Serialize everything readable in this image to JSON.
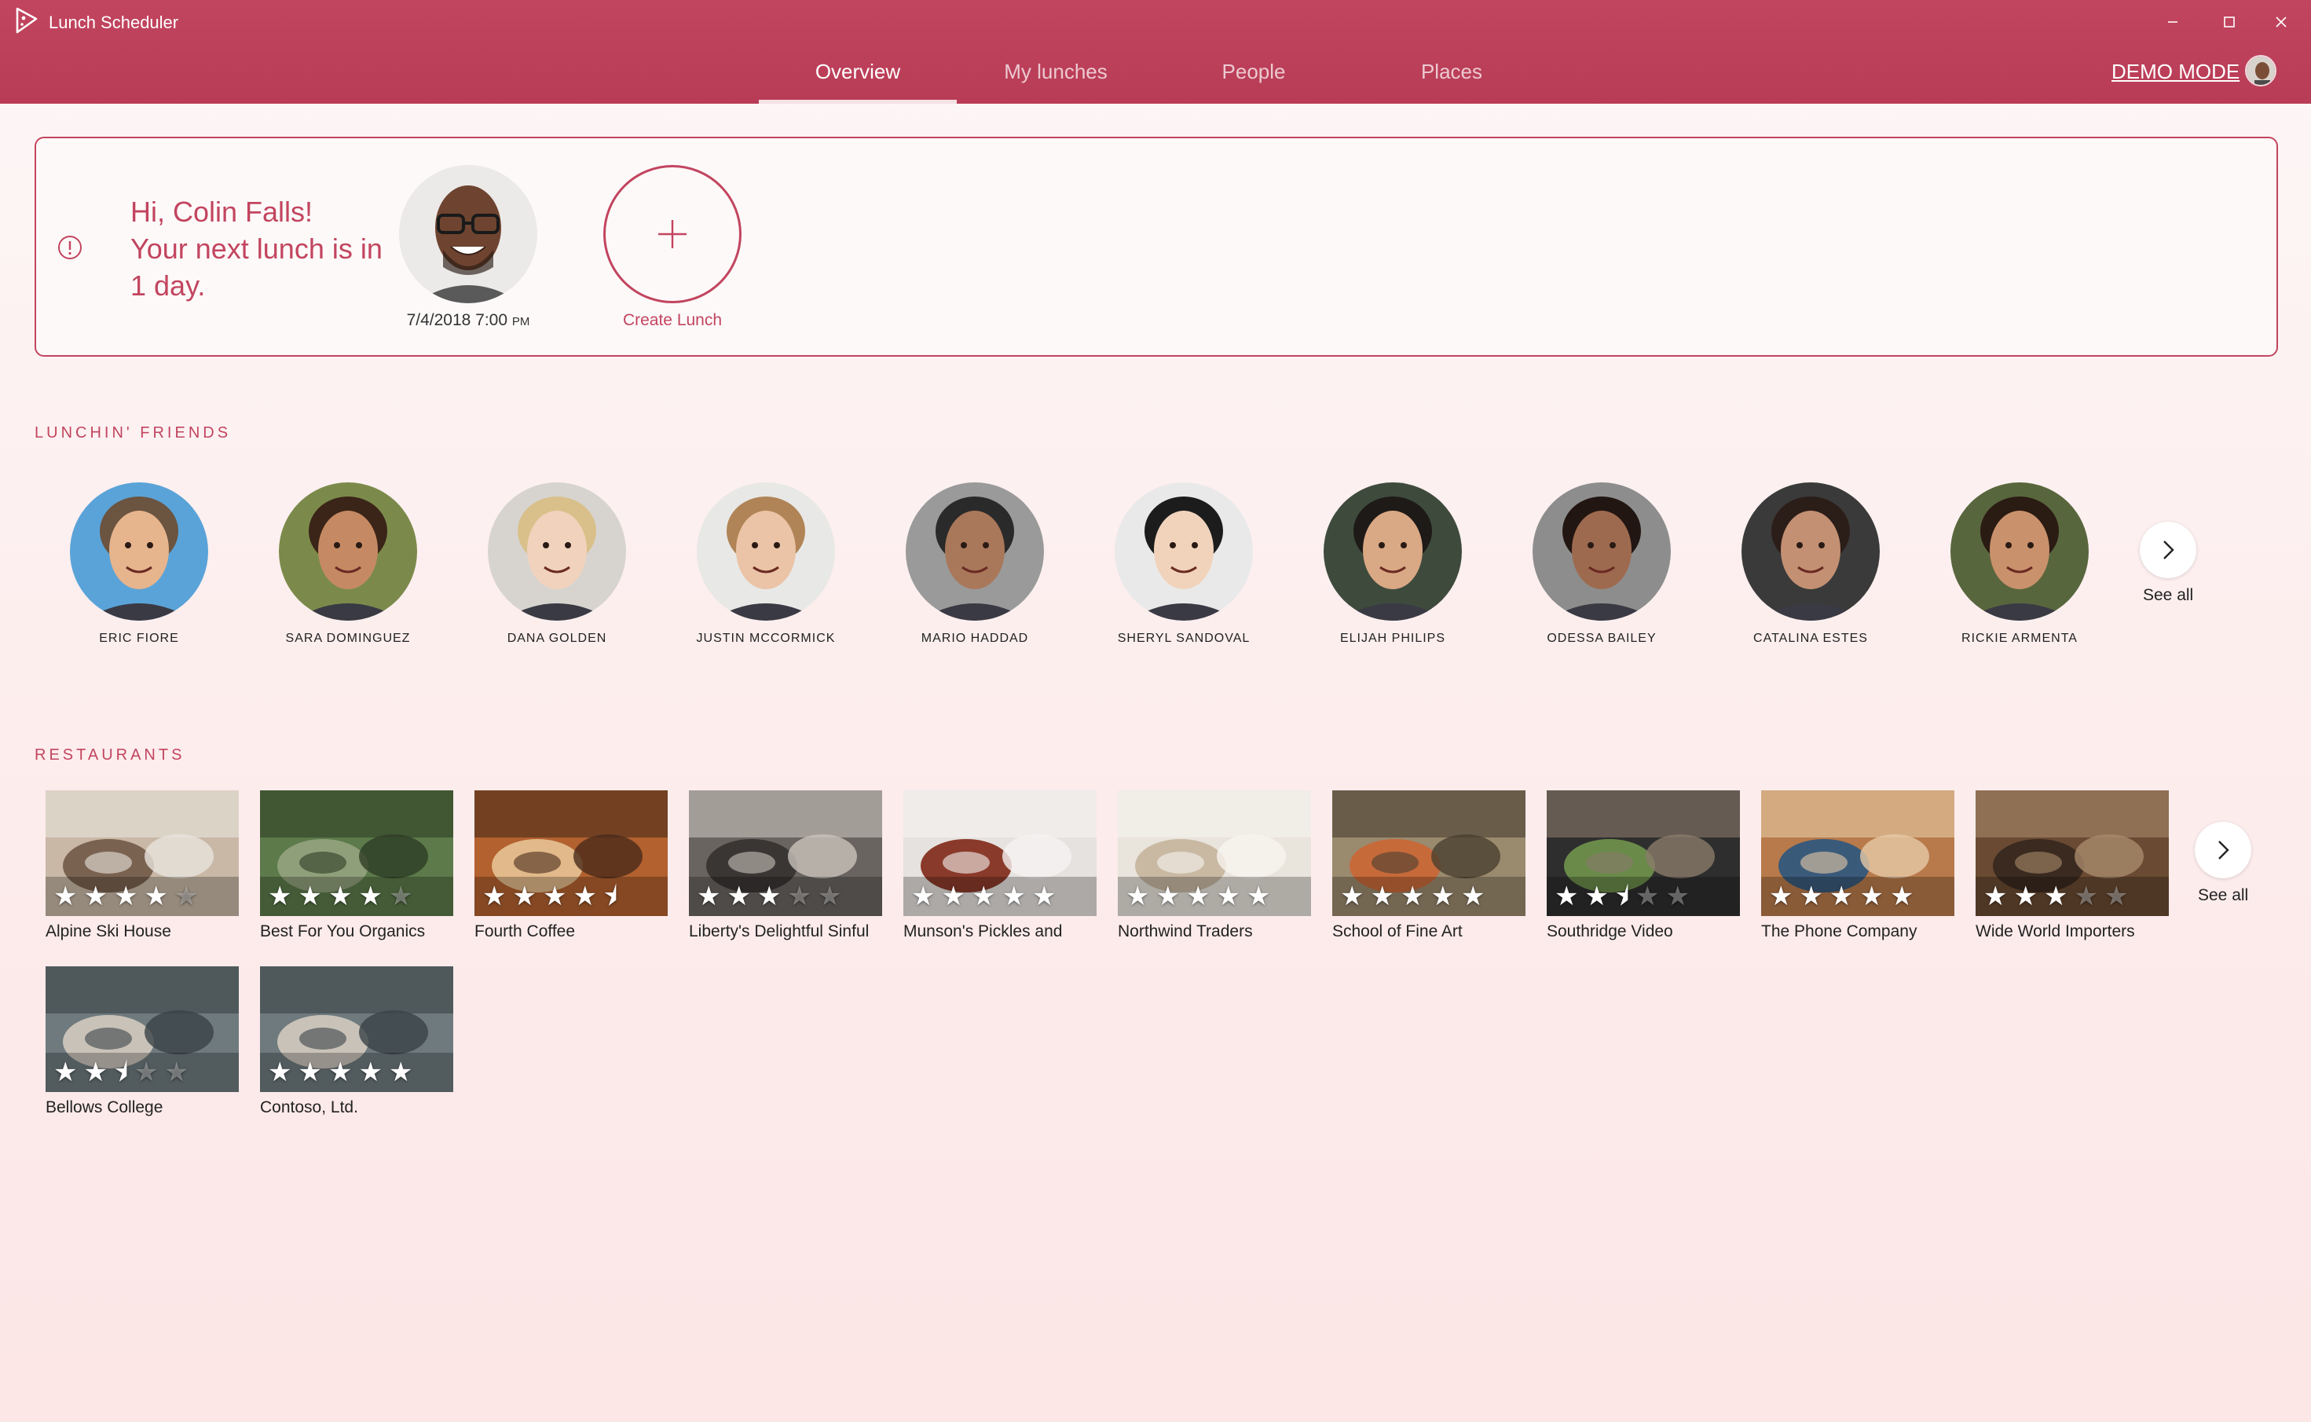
{
  "window": {
    "title": "Lunch Scheduler",
    "demo_mode_label": "DEMO MODE"
  },
  "nav": {
    "tabs": [
      {
        "label": "Overview",
        "active": true
      },
      {
        "label": "My lunches",
        "active": false
      },
      {
        "label": "People",
        "active": false
      },
      {
        "label": "Places",
        "active": false
      }
    ]
  },
  "welcome": {
    "greeting_line1": "Hi, Colin Falls!",
    "greeting_line2": "Your next lunch is in",
    "greeting_line3": "1 day.",
    "next_lunch_date": "7/4/2018 7:00",
    "next_lunch_ampm": "PM",
    "create_label": "Create Lunch"
  },
  "friends": {
    "title": "Lunchin' Friends",
    "see_all": "See all",
    "items": [
      {
        "name": "Eric Fiore",
        "skin": "#e6b48d",
        "hair": "#6b5440",
        "bg": "#5aa3d8"
      },
      {
        "name": "Sara Dominguez",
        "skin": "#c58a64",
        "hair": "#3b2418",
        "bg": "#7b8a4a"
      },
      {
        "name": "Dana Golden",
        "skin": "#f1d2bd",
        "hair": "#d9c08a",
        "bg": "#d7d4d0"
      },
      {
        "name": "Justin McCormick",
        "skin": "#ebc3a6",
        "hair": "#b08456",
        "bg": "#e8e8e6"
      },
      {
        "name": "Mario Haddad",
        "skin": "#a9775a",
        "hair": "#2a2a2a",
        "bg": "#9a9a9a"
      },
      {
        "name": "Sheryl Sandoval",
        "skin": "#f1d3bc",
        "hair": "#1c1c1c",
        "bg": "#e9e9e9"
      },
      {
        "name": "Elijah Philips",
        "skin": "#d9a884",
        "hair": "#1e1a18",
        "bg": "#3e4b3c"
      },
      {
        "name": "Odessa Bailey",
        "skin": "#9e6a4f",
        "hair": "#221612",
        "bg": "#8d8d8d"
      },
      {
        "name": "Catalina Estes",
        "skin": "#c49073",
        "hair": "#2b1d18",
        "bg": "#3a3a3a"
      },
      {
        "name": "Rickie Armenta",
        "skin": "#c9916c",
        "hair": "#2a1b13",
        "bg": "#58663d"
      }
    ]
  },
  "restaurants": {
    "title": "Restaurants",
    "see_all": "See all",
    "items": [
      {
        "name": "Alpine Ski House",
        "rating": 4,
        "c1": "#c9b8a6",
        "c2": "#7a6250",
        "c3": "#e9e4dd"
      },
      {
        "name": "Best For You Organics",
        "rating": 4,
        "c1": "#5c7a4a",
        "c2": "#8f9f7a",
        "c3": "#2e3d25"
      },
      {
        "name": "Fourth Coffee",
        "rating": 4.5,
        "c1": "#b2612f",
        "c2": "#e2b98a",
        "c3": "#4a2b1a"
      },
      {
        "name": "Liberty's Delightful Sinful",
        "rating": 3,
        "c1": "#6a6460",
        "c2": "#3a3634",
        "c3": "#c9c3bc"
      },
      {
        "name": "Munson's Pickles and",
        "rating": 5,
        "c1": "#e6e2df",
        "c2": "#8a3a2a",
        "c3": "#f5f3f1"
      },
      {
        "name": "Northwind Traders",
        "rating": 5,
        "c1": "#e9e4dc",
        "c2": "#c9b9a3",
        "c3": "#f7f4ef"
      },
      {
        "name": "School of Fine Art",
        "rating": 5,
        "c1": "#9a8a6e",
        "c2": "#c76a3a",
        "c3": "#4a4030"
      },
      {
        "name": "Southridge Video",
        "rating": 2.5,
        "c1": "#2e2e2e",
        "c2": "#6a8a4a",
        "c3": "#8a7a6a"
      },
      {
        "name": "The Phone Company",
        "rating": 5,
        "c1": "#b87a4a",
        "c2": "#3a5a7a",
        "c3": "#e6c9a6"
      },
      {
        "name": "Wide World Importers",
        "rating": 3,
        "c1": "#6a4a32",
        "c2": "#3a2a20",
        "c3": "#a88a6a"
      },
      {
        "name": "Bellows College",
        "rating": 2.5,
        "c1": "#6e7a7e",
        "c2": "#c9c2b8",
        "c3": "#3a4246"
      },
      {
        "name": "Contoso, Ltd.",
        "rating": 5,
        "c1": "#6e7a7e",
        "c2": "#c9c2b8",
        "c3": "#3a4246"
      }
    ]
  },
  "icons": {
    "app_logo": "pizza-slice-icon",
    "info": "info-icon",
    "plus": "plus-icon",
    "chevron": "chevron-right-icon",
    "star": "star-icon"
  },
  "colors": {
    "accent": "#c2455f",
    "header_bg": "#be4159",
    "background": "#fdf0f0"
  }
}
